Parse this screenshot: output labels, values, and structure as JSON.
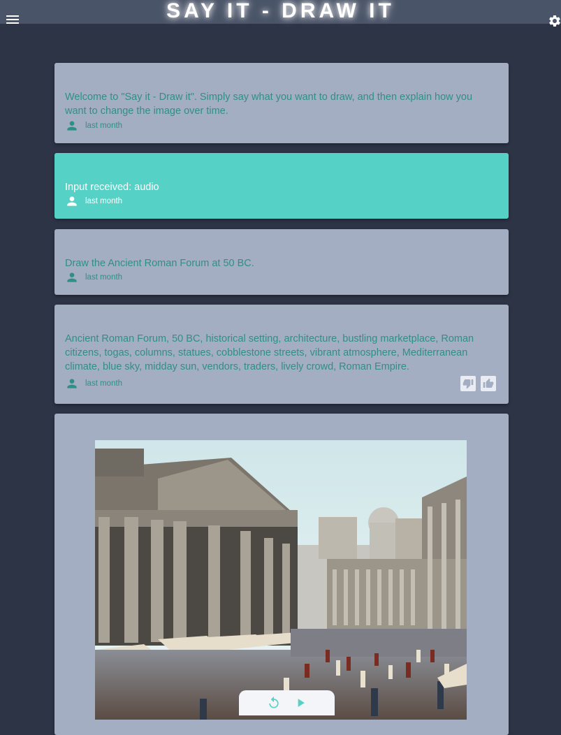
{
  "header": {
    "title": "SAY IT - DRAW IT"
  },
  "messages": [
    {
      "text": "Welcome to \"Say it - Draw it\".  Simply say what you want to draw, and then explain how you want to change the image over time.",
      "time": "last month"
    },
    {
      "text": "Input received: audio",
      "time": "last month"
    },
    {
      "text": "Draw the Ancient Roman Forum at 50 BC.",
      "time": "last month"
    },
    {
      "text": "Ancient Roman Forum, 50 BC, historical setting, architecture, bustling marketplace, Roman citizens, togas, columns, statues, cobblestone streets, vibrant atmosphere, Mediterranean climate, blue sky, midday sun, vendors, traders, lively crowd, Roman Empire.",
      "time": "last month"
    }
  ],
  "colors": {
    "background": "#2d3446",
    "card": "#a3aec2",
    "accent": "#55d1c5",
    "text_accent": "#2f8f86"
  },
  "icons": {
    "menu": "menu-icon",
    "settings": "gear-icon",
    "user": "person-icon",
    "thumbs_down": "thumbs-down-icon",
    "thumbs_up": "thumbs-up-icon",
    "replay": "replay-icon",
    "play": "play-icon"
  }
}
